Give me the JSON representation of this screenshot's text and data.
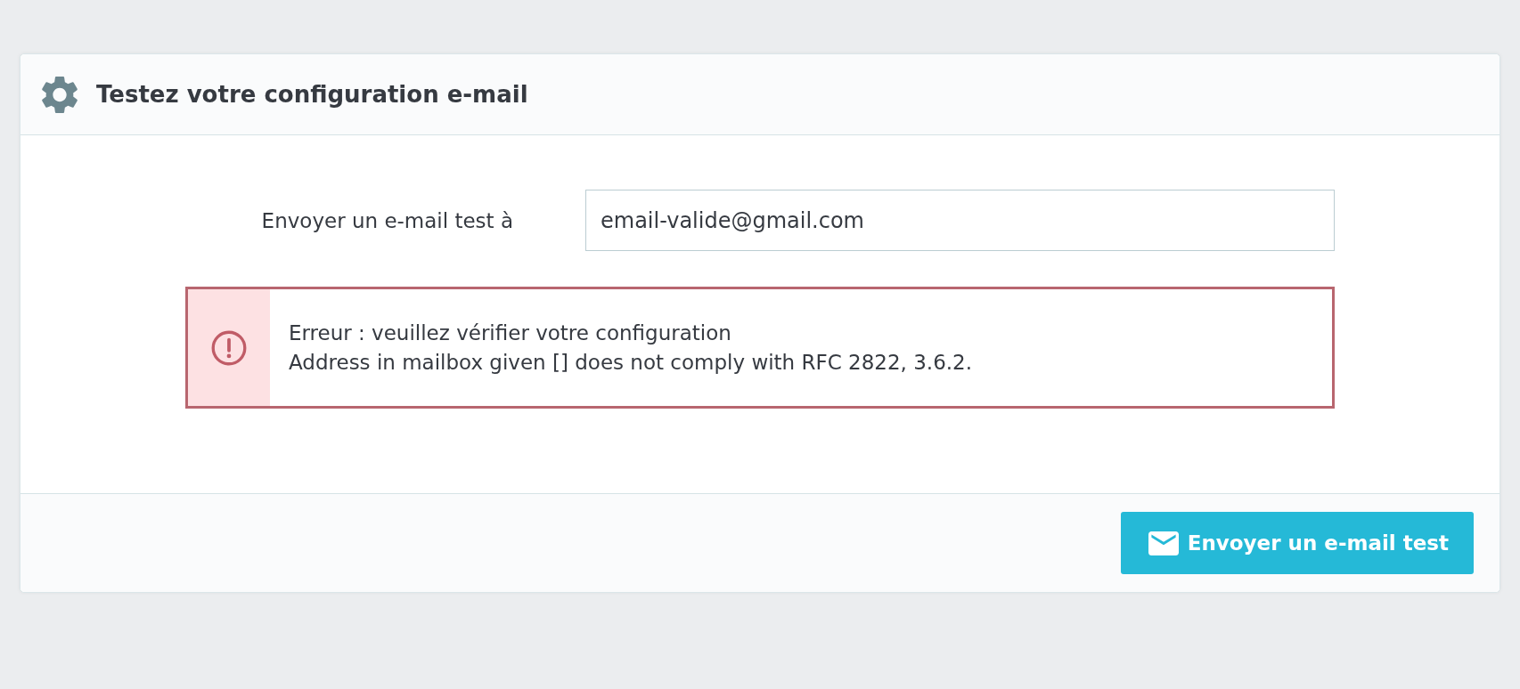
{
  "panel": {
    "title": "Testez votre configuration e-mail"
  },
  "form": {
    "fields": [
      {
        "label": "Envoyer un e-mail test à",
        "value": "email-valide@gmail.com"
      }
    ]
  },
  "alert": {
    "kind": "error",
    "title": "Erreur : veuillez vérifier votre configuration",
    "message": "Address in mailbox given [] does not comply with RFC 2822, 3.6.2."
  },
  "footer": {
    "buttons": [
      {
        "label": "Envoyer un e-mail test",
        "kind": "primary"
      }
    ]
  }
}
